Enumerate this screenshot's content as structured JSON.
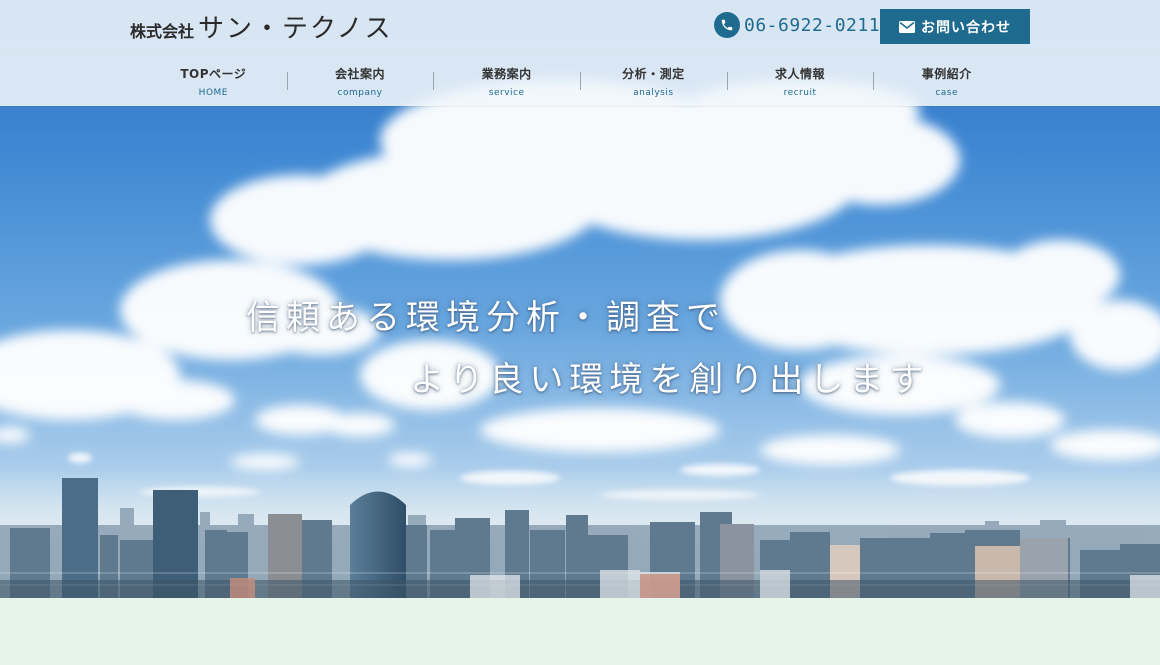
{
  "header": {
    "company_prefix": "株式会社",
    "company_name": "サン・テクノス",
    "phone": "06-6922-0211",
    "contact_label": "お問い合わせ"
  },
  "nav": [
    {
      "ja": "TOPページ",
      "en": "HOME"
    },
    {
      "ja": "会社案内",
      "en": "company"
    },
    {
      "ja": "業務案内",
      "en": "service"
    },
    {
      "ja": "分析・測定",
      "en": "analysis"
    },
    {
      "ja": "求人情報",
      "en": "recruit"
    },
    {
      "ja": "事例紹介",
      "en": "case"
    }
  ],
  "hero": {
    "line1": "信頼ある環境分析・調査で",
    "line2": "より良い環境を創り出します"
  },
  "colors": {
    "accent": "#1f6a8f",
    "footer_band": "#e6f4ea"
  },
  "icons": {
    "phone": "phone-icon",
    "contact": "mail-icon"
  }
}
